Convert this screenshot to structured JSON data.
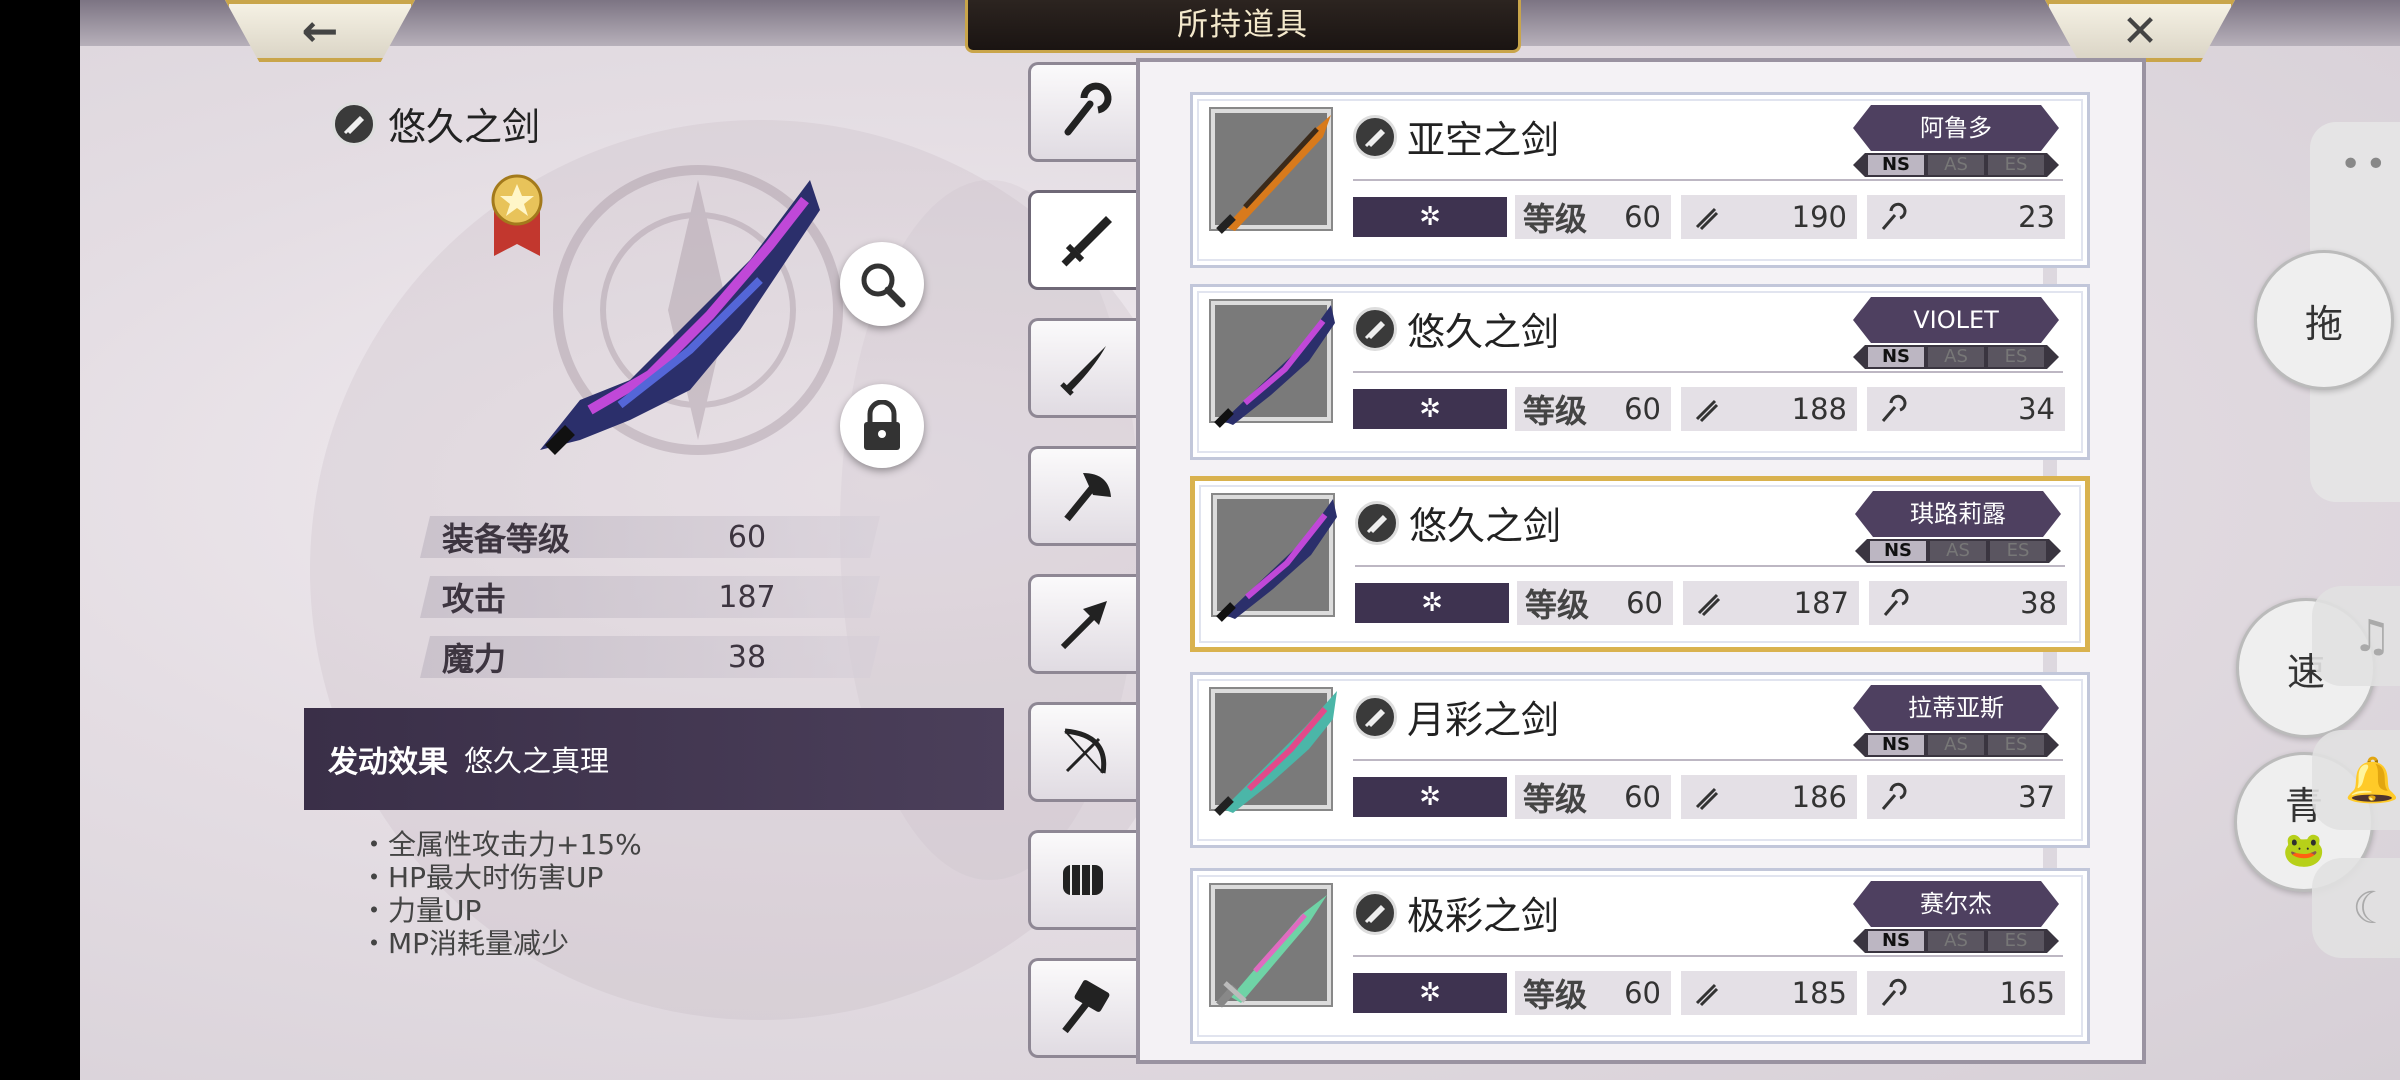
{
  "header": {
    "title": "所持道具",
    "back_icon": "←",
    "close_icon": "✕"
  },
  "detail": {
    "name": "悠久之剑",
    "stats": [
      {
        "label": "装备等级",
        "value": "60"
      },
      {
        "label": "攻击",
        "value": "187"
      },
      {
        "label": "魔力",
        "value": "38"
      }
    ],
    "effect_label": "发动效果",
    "effect_name": "悠久之真理",
    "effects": [
      "全属性攻击力+15%",
      "HP最大时伤害UP",
      "力量UP",
      "MP消耗量减少"
    ]
  },
  "tabs": [
    "staff",
    "sword",
    "katana",
    "axe",
    "spear",
    "bow",
    "fist",
    "hammer"
  ],
  "list": {
    "level_label": "等级",
    "rarity_symbol": "✲",
    "version_tags": [
      "NS",
      "AS",
      "ES"
    ],
    "items": [
      {
        "name": "亚空之剑",
        "owner": "阿鲁多",
        "level": "60",
        "atk": "190",
        "mag": "23",
        "selected": false
      },
      {
        "name": "悠久之剑",
        "owner": "VIOLET",
        "level": "60",
        "atk": "188",
        "mag": "34",
        "selected": false
      },
      {
        "name": "悠久之剑",
        "owner": "琪路莉露",
        "level": "60",
        "atk": "187",
        "mag": "38",
        "selected": true
      },
      {
        "name": "月彩之剑",
        "owner": "拉蒂亚斯",
        "level": "60",
        "atk": "186",
        "mag": "37",
        "selected": false
      },
      {
        "name": "极彩之剑",
        "owner": "赛尔杰",
        "level": "60",
        "atk": "185",
        "mag": "165",
        "selected": false
      }
    ]
  },
  "overlay": {
    "dots": "••",
    "btn1": "拖",
    "btn2": "速",
    "btn3": "青",
    "frog": "🐸",
    "music_icon": "♫",
    "bell_icon": "🔔",
    "moon_icon": "☾"
  },
  "colors": {
    "accent_purple": "#4e4060",
    "gold": "#d9b24e"
  }
}
